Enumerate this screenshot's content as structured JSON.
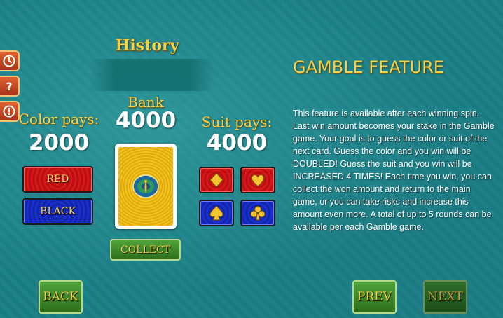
{
  "history": {
    "title": "History"
  },
  "bank": {
    "label": "Bank",
    "value": "4000"
  },
  "color_pays": {
    "label": "Color pays:",
    "value": "2000"
  },
  "suit_pays": {
    "label": "Suit pays:",
    "value": "4000"
  },
  "buttons": {
    "red": "RED",
    "black": "BLACK",
    "collect": "COLLECT",
    "back": "BACK",
    "prev": "PREV",
    "next": "NEXT"
  },
  "side_icons": [
    "clock-icon",
    "help-icon",
    "warning-icon"
  ],
  "suits": [
    "diamonds",
    "hearts",
    "spades",
    "clubs"
  ],
  "gamble": {
    "title": "GAMBLE FEATURE",
    "text": "This feature is available after each winning spin. Last win amount becomes your stake in the Gamble game. Your goal is to guess the color or suit of the next card. Guess the color and you win will be DOUBLED! Guess the suit and you win will be INCREASED 4 TIMES! Each time you win, you can collect the won amount and return to the main game, or you can take risks and increase this amount even more. A total of up to 5 rounds can be available per each Gamble game."
  },
  "colors": {
    "gold_text": "#f4d24a",
    "background": "#1b7f86",
    "red_button": "#d8171a",
    "blue_button": "#1a2fd0",
    "green_button": "#4fa43a"
  }
}
